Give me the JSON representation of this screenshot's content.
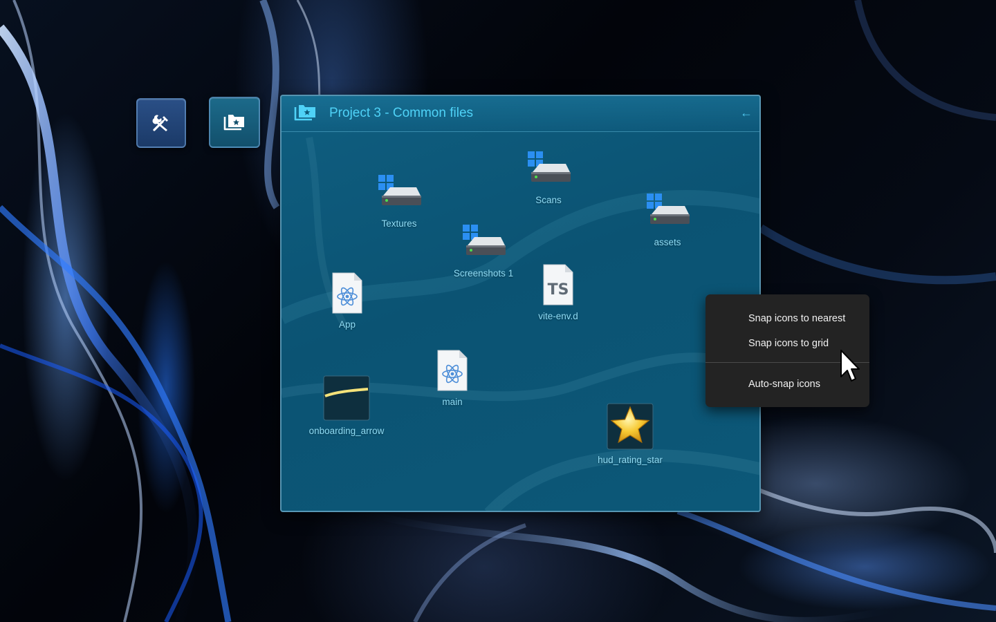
{
  "desktop": {
    "dock": [
      {
        "name": "tools",
        "icon": "tools-icon"
      },
      {
        "name": "favorite-folder",
        "icon": "folder-star-icon"
      }
    ]
  },
  "window": {
    "title": "Project 3 - Common files",
    "title_icon": "folder-star-icon",
    "back_icon": "arrow-left-icon",
    "back_glyph": "←",
    "accent_color": "#4fd2f7",
    "items": [
      {
        "label": "Textures",
        "icon": "drive-icon"
      },
      {
        "label": "Scans",
        "icon": "drive-icon"
      },
      {
        "label": "assets",
        "icon": "drive-icon"
      },
      {
        "label": "Screenshots 1",
        "icon": "drive-icon"
      },
      {
        "label": "App",
        "icon": "react-file-icon"
      },
      {
        "label": "vite-env.d",
        "icon": "typescript-file-icon",
        "badge": "TS"
      },
      {
        "label": "main",
        "icon": "react-file-icon"
      },
      {
        "label": "onboarding_arrow",
        "icon": "image-thumbnail-icon"
      },
      {
        "label": "hud_rating_star",
        "icon": "star-image-icon"
      }
    ]
  },
  "context_menu": {
    "items": [
      {
        "label": "Snap icons to nearest"
      },
      {
        "label": "Snap icons to grid"
      },
      {
        "label": "Auto-snap icons"
      }
    ],
    "background": "#232323"
  },
  "cursor": {
    "icon": "mouse-pointer-icon"
  }
}
